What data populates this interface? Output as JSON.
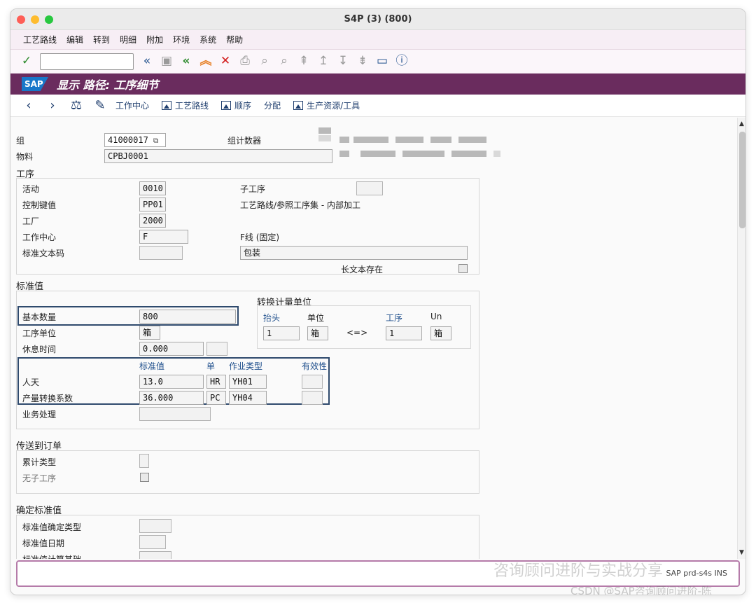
{
  "window": {
    "title": "S4P (3) (800)"
  },
  "menu": [
    "工艺路线",
    "编辑",
    "转到",
    "明细",
    "附加",
    "环境",
    "系统",
    "帮助"
  ],
  "header": {
    "logo": "SAP",
    "title": "显示 路径: 工序细节"
  },
  "app_toolbar": {
    "work_center": "工作中心",
    "routing": "工艺路线",
    "sequence": "顺序",
    "assign": "分配",
    "prt": "生产资源/工具"
  },
  "top": {
    "group_label": "组",
    "group_value": "41000017",
    "group_counter_label": "组计数器",
    "material_label": "物料",
    "material_value": "CPBJ0001"
  },
  "operation": {
    "title": "工序",
    "activity_label": "活动",
    "activity_value": "0010",
    "sub_operation_label": "子工序",
    "control_key_label": "控制键值",
    "control_key_value": "PP01",
    "control_key_desc": "工艺路线/参照工序集 - 内部加工",
    "plant_label": "工厂",
    "plant_value": "2000",
    "work_center_label": "工作中心",
    "work_center_value": "F",
    "work_center_desc": "F线 (固定)",
    "std_text_label": "标准文本码",
    "description_value": "包装",
    "long_text_label": "长文本存在"
  },
  "standard_values": {
    "title": "标准值",
    "base_qty_label": "基本数量",
    "base_qty_value": "800",
    "op_unit_label": "工序单位",
    "op_unit_value": "箱",
    "break_time_label": "休息时间",
    "break_time_value": "0.000",
    "col_std_value": "标准值",
    "col_unit": "单",
    "col_activity_type": "作业类型",
    "col_effectivity": "有效性",
    "rows": [
      {
        "label": "人天",
        "value": "13.0",
        "unit": "HR",
        "activity_type": "YH01"
      },
      {
        "label": "产量转换系数",
        "value": "36.000",
        "unit": "PC",
        "activity_type": "YH04"
      }
    ],
    "business_process_label": "业务处理"
  },
  "conversion": {
    "title": "转换计量单位",
    "header_label": "抬头",
    "unit_label": "单位",
    "operation_label": "工序",
    "un_label": "Un",
    "header_qty": "1",
    "header_unit": "箱",
    "arrow": "<=>",
    "op_qty": "1",
    "op_unit": "箱"
  },
  "transfer": {
    "title": "传送到订单",
    "cumulation_label": "累计类型",
    "no_sub_label": "无子工序"
  },
  "determine": {
    "title": "确定标准值",
    "type_label": "标准值确定类型",
    "date_label": "标准值日期",
    "basis_label": "标准值计算基础"
  },
  "status": {
    "text": "SAP  prd-s4s INS"
  },
  "watermark": {
    "main": "咨询顾问进阶与实战分享",
    "sub": "CSDN @SAP咨询顾问进阶-陈"
  }
}
